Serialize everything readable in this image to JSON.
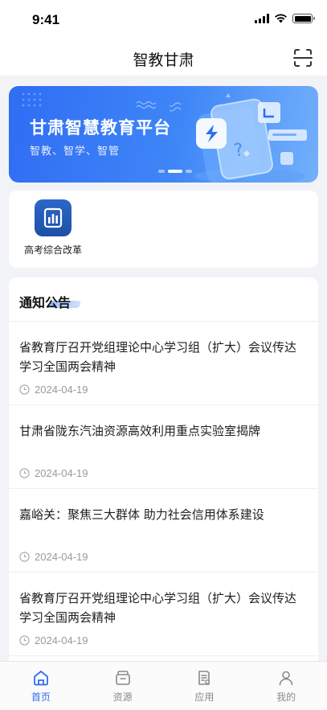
{
  "status_bar": {
    "time": "9:41"
  },
  "nav": {
    "title": "智教甘肃",
    "scan_icon": "scan-icon"
  },
  "banner": {
    "title": "甘肃智慧教育平台",
    "subtitle": "智教、智学、智管",
    "slide_count": 3,
    "active_slide": 2
  },
  "quick_entries": [
    {
      "label": "高考综合改革",
      "icon": "report-chart-icon",
      "color": "#2c68c8"
    }
  ],
  "notices": {
    "heading": "通知公告",
    "items": [
      {
        "title": "省教育厅召开党组理论中心学习组（扩大）会议传达学习全国两会精神",
        "date": "2024-04-19"
      },
      {
        "title": "甘肃省陇东汽油资源高效利用重点实验室揭牌",
        "date": "2024-04-19"
      },
      {
        "title": "嘉峪关：聚焦三大群体 助力社会信用体系建设",
        "date": "2024-04-19"
      },
      {
        "title": "省教育厅召开党组理论中心学习组（扩大）会议传达学习全国两会精神",
        "date": "2024-04-19"
      }
    ]
  },
  "tab_bar": {
    "items": [
      {
        "label": "首页",
        "icon": "home-icon",
        "active": true
      },
      {
        "label": "资源",
        "icon": "resource-box-icon",
        "active": false
      },
      {
        "label": "应用",
        "icon": "app-doc-icon",
        "active": false
      },
      {
        "label": "我的",
        "icon": "profile-icon",
        "active": false
      }
    ]
  },
  "colors": {
    "accent": "#2f6df3",
    "inactive": "#8a8a8a",
    "background": "#f2f3f7"
  }
}
